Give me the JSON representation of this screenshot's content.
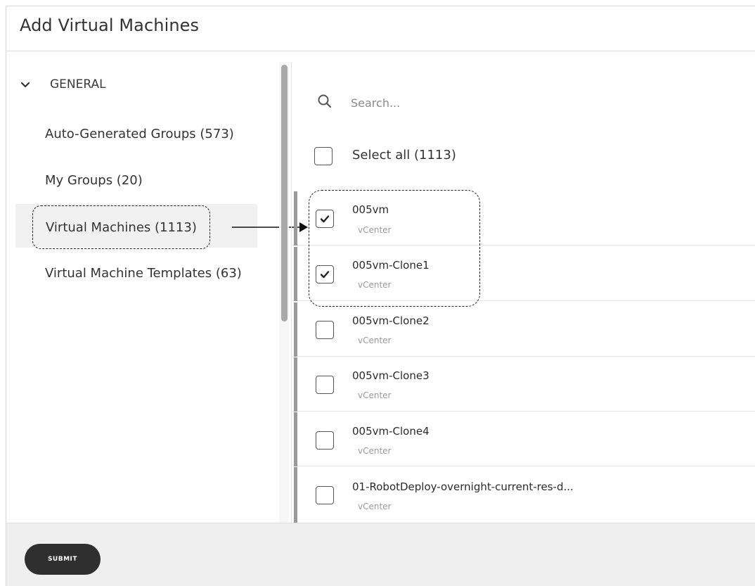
{
  "dialog": {
    "title": "Add Virtual Machines"
  },
  "nav": {
    "section_label": "GENERAL",
    "items": [
      {
        "label": "Auto-Generated Groups (573)",
        "selected": false
      },
      {
        "label": "My Groups (20)",
        "selected": false
      },
      {
        "label": "Virtual Machines (1113)",
        "selected": true
      },
      {
        "label": "Virtual Machine Templates (63)",
        "selected": false
      }
    ]
  },
  "search": {
    "placeholder": "Search...",
    "value": ""
  },
  "select_all": {
    "label": "Select all (1113)",
    "checked": false
  },
  "list": [
    {
      "name": "005vm",
      "source": "vCenter",
      "checked": true
    },
    {
      "name": "005vm-Clone1",
      "source": "vCenter",
      "checked": true
    },
    {
      "name": "005vm-Clone2",
      "source": "vCenter",
      "checked": false
    },
    {
      "name": "005vm-Clone3",
      "source": "vCenter",
      "checked": false
    },
    {
      "name": "005vm-Clone4",
      "source": "vCenter",
      "checked": false
    },
    {
      "name": "01-RobotDeploy-overnight-current-res-d...",
      "source": "vCenter",
      "checked": false
    }
  ],
  "footer": {
    "submit_label": "SUBMIT"
  },
  "icons": {
    "section_toggle": "chevron-down-icon",
    "search": "search-icon",
    "check": "checkmark-icon"
  },
  "colors": {
    "submit_bg": "#2f2f2f",
    "selected_nav_bg": "#f1f1f1",
    "footer_bg": "#efefef"
  }
}
